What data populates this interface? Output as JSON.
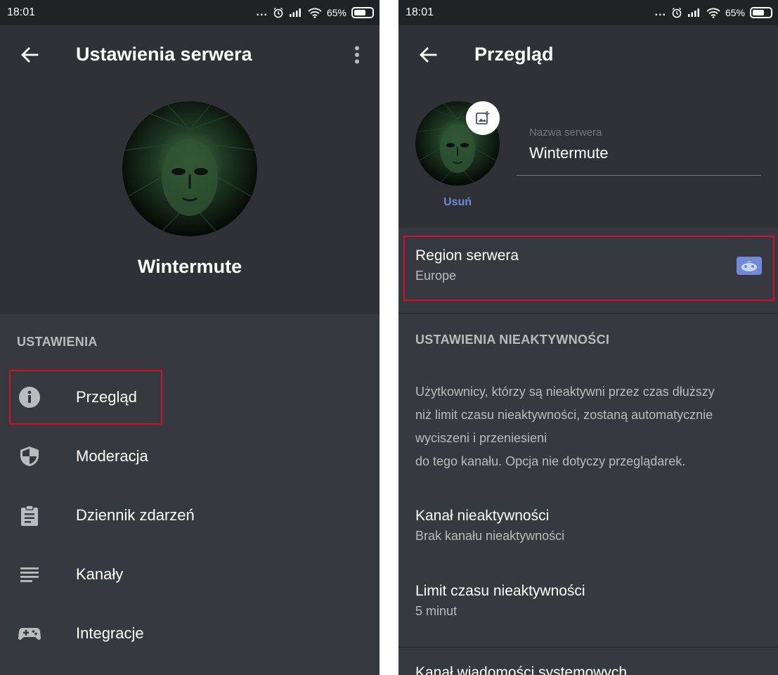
{
  "status_bar": {
    "time": "18:01",
    "dots": "...",
    "battery_percent": "65%",
    "battery_level": 0.65,
    "icons": [
      "alarm-icon",
      "signal-icon",
      "wifi-icon",
      "battery-icon"
    ]
  },
  "left": {
    "appbar": {
      "title": "Ustawienia serwera",
      "back_icon": "arrow-left-icon",
      "menu_icon": "more-vertical-icon"
    },
    "server": {
      "name": "Wintermute"
    },
    "section_label": "USTAWIENIA",
    "menu": [
      {
        "label": "Przegląd",
        "icon": "info-icon"
      },
      {
        "label": "Moderacja",
        "icon": "shield-icon"
      },
      {
        "label": "Dziennik zdarzeń",
        "icon": "clipboard-icon"
      },
      {
        "label": "Kanały",
        "icon": "list-icon"
      },
      {
        "label": "Integracje",
        "icon": "gamepad-icon"
      }
    ]
  },
  "right": {
    "appbar": {
      "title": "Przegląd",
      "back_icon": "arrow-left-icon"
    },
    "overview": {
      "remove_label": "Usuń",
      "name_label": "Nazwa serwera",
      "name_value": "Wintermute",
      "upload_icon": "add-image-icon"
    },
    "region": {
      "title": "Region serwera",
      "value": "Europe",
      "flag_icon": "region-flag-icon"
    },
    "inactivity": {
      "section_label": "USTAWIENIA NIEAKTYWNOŚCI",
      "description_lines": [
        "Użytkownicy, którzy są nieaktywni przez czas dłuższy",
        "niż limit czasu nieaktywności, zostaną automatycznie",
        "wyciszeni i przeniesieni",
        "do tego kanału. Opcja nie dotyczy przeglądarek."
      ],
      "channel_title": "Kanał nieaktywności",
      "channel_value": "Brak kanału nieaktywności",
      "timeout_title": "Limit czasu nieaktywności",
      "timeout_value": "5 minut",
      "system_title": "Kanał wiadomości systemowych"
    }
  },
  "colors": {
    "background": "#36393f",
    "header": "#2f3136",
    "status_bar": "#202225",
    "accent": "#7289da",
    "highlight": "#d50f25"
  }
}
